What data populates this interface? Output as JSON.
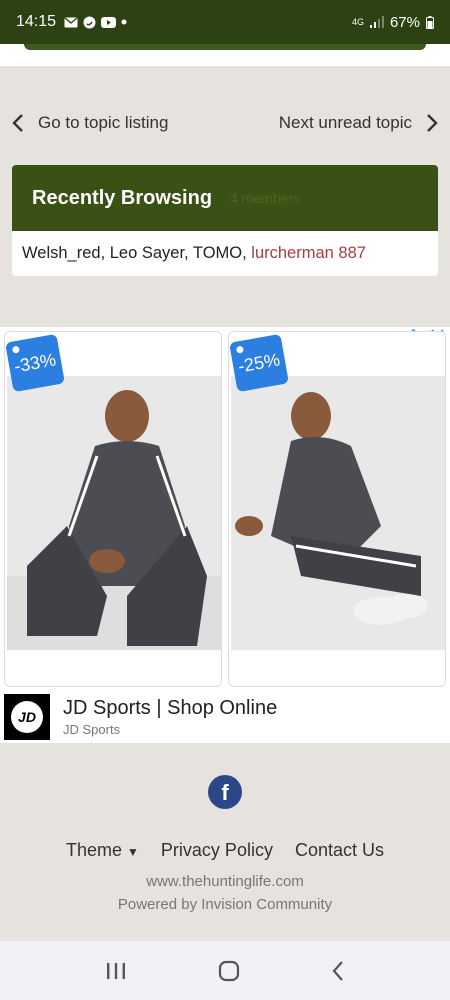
{
  "status_bar": {
    "time": "14:15",
    "network": "4G",
    "battery": "67%"
  },
  "pager": {
    "prev_label": "Go to topic listing",
    "next_label": "Next unread topic"
  },
  "recently_browsing": {
    "title": "Recently Browsing",
    "subtitle": "4 members",
    "users_plain": "Welsh_red, Leo Sayer, TOMO, ",
    "user_highlight": "lurcherman 887"
  },
  "ad": {
    "cards": [
      {
        "discount": "-33%"
      },
      {
        "discount": "-25%"
      }
    ],
    "headline": "JD Sports | Shop Online",
    "advertiser": "JD Sports",
    "logo_text": "JD"
  },
  "footer": {
    "theme_label": "Theme",
    "privacy_label": "Privacy Policy",
    "contact_label": "Contact Us",
    "site": "www.thehuntinglife.com",
    "powered": "Powered by Invision Community"
  },
  "colors": {
    "brand_green": "#3a5115",
    "status_green": "#2c4212",
    "highlight_red": "#a4403b",
    "badge_blue": "#2a7fe0",
    "facebook_blue": "#2a4887"
  },
  "icons": [
    "mail-icon",
    "whatsapp-icon",
    "youtube-icon",
    "signal-icon",
    "battery-icon",
    "chevron-left-icon",
    "chevron-right-icon",
    "adchoices-icon",
    "close-icon",
    "facebook-icon",
    "caret-down-icon",
    "recent-apps-icon",
    "home-icon",
    "back-icon"
  ]
}
